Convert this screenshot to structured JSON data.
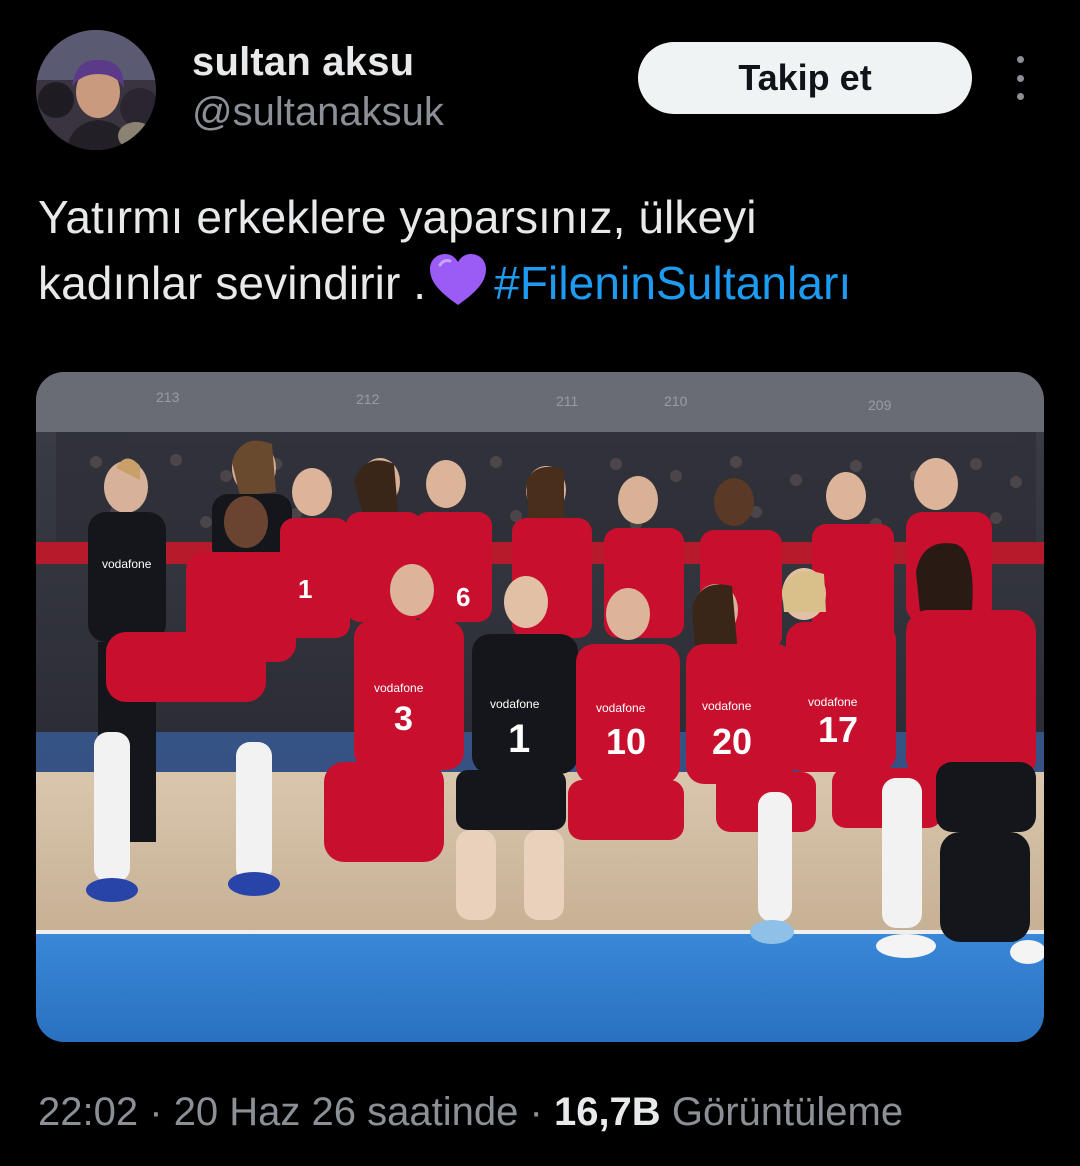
{
  "author": {
    "display_name": "sultan aksu",
    "handle": "@sultanaksuk"
  },
  "follow_label": "Takip et",
  "tweet": {
    "text_line1": "Yatırmı erkeklere yaparsınız, ülkeyi",
    "text_line2": "kadınlar sevindirir .",
    "hashtag": "#FileninSultanları",
    "emoji": "purple-heart-icon"
  },
  "media": {
    "section_numbers": [
      "213",
      "212",
      "211",
      "210",
      "209"
    ],
    "jersey_numbers": [
      "1",
      "6",
      "3",
      "1",
      "10",
      "20",
      "17"
    ],
    "sponsor": "vodafone"
  },
  "meta": {
    "time": "22:02",
    "separator": "·",
    "date": "20 Haz 26 saatinde",
    "views_count": "16,7B",
    "views_label": "Görüntüleme"
  },
  "colors": {
    "background": "#000000",
    "text": "#e7e9ea",
    "secondary": "#8b9097",
    "link": "#1d9bf0",
    "button_bg": "#eff3f4",
    "jersey_red": "#c8102e",
    "court_blue": "#2f7fd1"
  }
}
